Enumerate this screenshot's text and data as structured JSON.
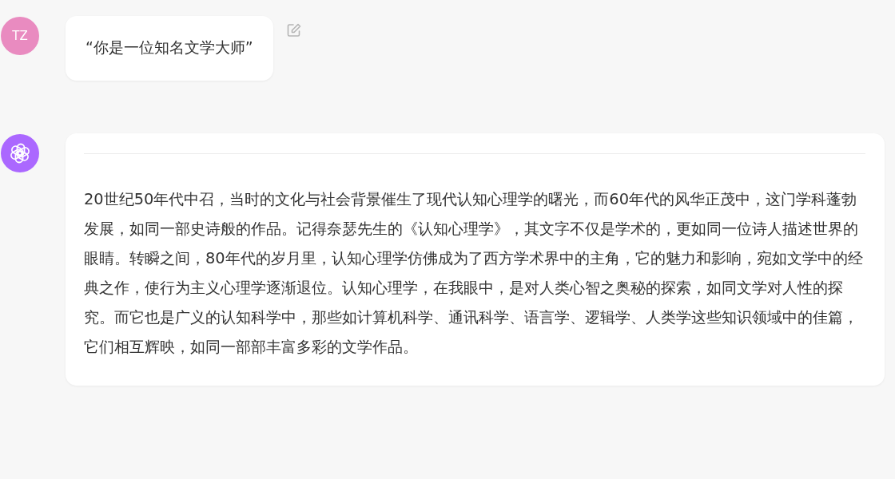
{
  "messages": [
    {
      "kind": "user",
      "avatar": "TZ",
      "color": "#e98bc0",
      "text": "“你是一位知名文学大师”"
    },
    {
      "kind": "assistant",
      "color": "#ab68ff",
      "text": "20世纪50年代中召，当时的文化与社会背景催生了现代认知心理学的曙光，而60年代的风华正茂中，这门学科蓬勃发展，如同一部史诗般的作品。记得奈瑟先生的《认知心理学》，其文字不仅是学术的，更如同一位诗人描述世界的眼睛。转瞬之间，80年代的岁月里，认知心理学仿佛成为了西方学术界中的主角，它的魅力和影响，宛如文学中的经典之作，使行为主义心理学逐渐退位。认知心理学，在我眼中，是对人类心智之奥秘的探索，如同文学对人性的探究。而它也是广义的认知科学中，那些如计算机科学、通讯科学、语言学、逻辑学、人类学这些知识领域中的佳篇，它们相互辉映，如同一部部丰富多彩的文学作品。"
    }
  ]
}
